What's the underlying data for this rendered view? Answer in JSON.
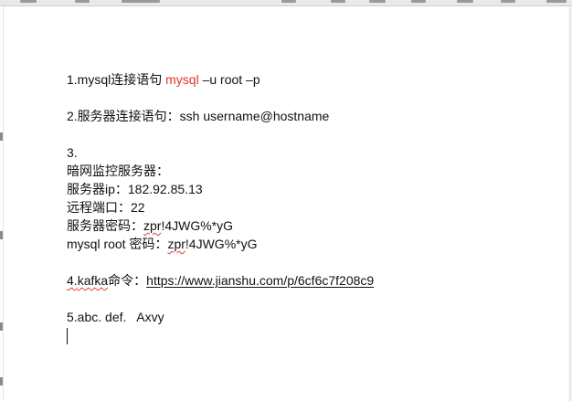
{
  "doc": {
    "l1_prefix": "1.mysql连接语句 ",
    "l1_keyword": "mysql",
    "l1_suffix": " –u root –p",
    "l2": "2.服务器连接语句：ssh username@hostname",
    "l3": "3.",
    "l4": "暗网监控服务器：",
    "l5": "服务器ip：182.92.85.13",
    "l6": "远程端口：22",
    "l7_prefix": "服务器密码：",
    "l7_spell": "zpr",
    "l7_rest": "!4JWG%*yG",
    "l8_prefix": "mysql root 密码：",
    "l8_spell": "zpr",
    "l8_rest": "!4JWG%*yG",
    "l9_num": "4.",
    "l9_spell": "kafka",
    "l9_label": "命令：",
    "l9_link": "https://www.jianshu.com/p/6cf6c7f208c9",
    "l10": "5.abc. def.   Axvy"
  },
  "colors": {
    "keyword": "#e5332a",
    "spellcheck_underline": "#e23b3b"
  }
}
